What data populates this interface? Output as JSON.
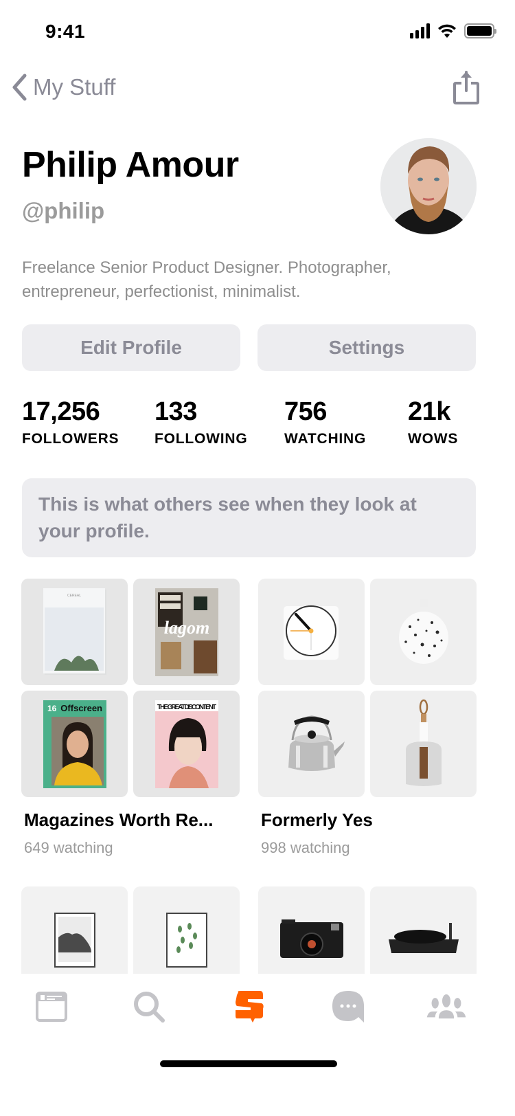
{
  "status_bar": {
    "time": "9:41"
  },
  "nav": {
    "back_label": "My Stuff"
  },
  "profile": {
    "name": "Philip Amour",
    "handle": "@philip",
    "bio": "Freelance Senior Product Designer. Photographer, entrepreneur, perfectionist, minimalist."
  },
  "actions": {
    "edit_label": "Edit Profile",
    "settings_label": "Settings"
  },
  "stats": [
    {
      "value": "17,256",
      "label": "FOLLOWERS"
    },
    {
      "value": "133",
      "label": "FOLLOWING"
    },
    {
      "value": "756",
      "label": "WATCHING"
    },
    {
      "value": "21k",
      "label": "WOWS"
    }
  ],
  "notice": "This is what others see when they look at your profile.",
  "collections": [
    {
      "title": "Magazines Worth Re...",
      "subtitle": "649 watching",
      "items": [
        "Cereal magazine",
        "Lagom magazine",
        "Offscreen magazine",
        "The Great Discontent magazine"
      ]
    },
    {
      "title": "Formerly Yes",
      "subtitle": "998 watching",
      "items": [
        "Braun clock",
        "Speckled vase",
        "Steel kettle",
        "Dustpan and brush"
      ]
    },
    {
      "title": "",
      "subtitle": "",
      "items": [
        "Framed mountain print",
        "Framed plant print"
      ]
    },
    {
      "title": "",
      "subtitle": "",
      "items": [
        "Rangefinder camera",
        "Turntable"
      ]
    }
  ],
  "tab_bar": {
    "tabs": [
      {
        "name": "feed",
        "icon": "feed-icon",
        "active": false
      },
      {
        "name": "search",
        "icon": "search-icon",
        "active": false
      },
      {
        "name": "home",
        "icon": "brand-logo-icon",
        "active": true
      },
      {
        "name": "messages",
        "icon": "chat-bubble-icon",
        "active": false
      },
      {
        "name": "community",
        "icon": "people-icon",
        "active": false
      }
    ],
    "active_color": "#ff6100",
    "inactive_color": "#c4c4c8"
  }
}
